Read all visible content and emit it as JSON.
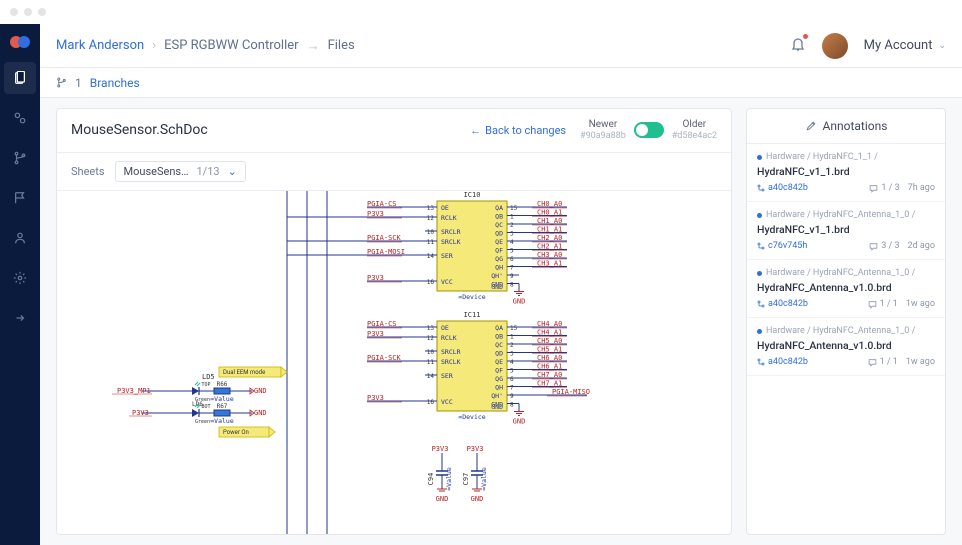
{
  "breadcrumb": {
    "user": "Mark Anderson",
    "project": "ESP RGBWW Controller",
    "page": "Files"
  },
  "account": {
    "label": "My Account"
  },
  "subbar": {
    "branch_count": "1",
    "branches_label": "Branches"
  },
  "doc": {
    "title": "MouseSensor.SchDoc"
  },
  "compare": {
    "back": "Back to changes",
    "newer": "Newer",
    "newer_hash": "#90a9a88b",
    "older": "Older",
    "older_hash": "#d58e4ac2"
  },
  "sheets": {
    "label": "Sheets",
    "name": "MouseSens…",
    "index": "1/13"
  },
  "annotations_title": "Annotations",
  "annotations": [
    {
      "path": "Hardware / HydraNFC_1_1 /",
      "file": "HydraNFC_v1_1.brd",
      "hash": "a40c842b",
      "count": "1 / 3",
      "time": "7h ago"
    },
    {
      "path": "Hardware / HydraNFC_Antenna_1_0 /",
      "file": "HydraNFC_v1_1.brd",
      "hash": "c76v745h",
      "count": "3 / 3",
      "time": "2d ago"
    },
    {
      "path": "Hardware / HydraNFC_Antenna_1_0 /",
      "file": "HydraNFC_Antenna_v1.0.brd",
      "hash": "a40c842b",
      "count": "1 / 1",
      "time": "1w ago"
    },
    {
      "path": "Hardware / HydraNFC_Antenna_1_0 /",
      "file": "HydraNFC_Antenna_v1.0.brd",
      "hash": "a40c842b",
      "count": "1 / 1",
      "time": "1w ago"
    }
  ],
  "schematic": {
    "ics": [
      "IC10",
      "IC11"
    ],
    "ic_pins_left": [
      {
        "n": "13",
        "lbl": "OE"
      },
      {
        "n": "12",
        "lbl": "RCLK"
      },
      {
        "n": "10",
        "lbl": "SRCLR"
      },
      {
        "n": "11",
        "lbl": "SRCLK"
      },
      {
        "n": "14",
        "lbl": "SER"
      },
      {
        "n": "16",
        "lbl": "VCC"
      }
    ],
    "ic_pins_right": [
      {
        "n": "15",
        "lbl": "QA"
      },
      {
        "n": "1",
        "lbl": "QB"
      },
      {
        "n": "2",
        "lbl": "QC"
      },
      {
        "n": "3",
        "lbl": "QD"
      },
      {
        "n": "4",
        "lbl": "QE"
      },
      {
        "n": "5",
        "lbl": "QF"
      },
      {
        "n": "6",
        "lbl": "QG"
      },
      {
        "n": "7",
        "lbl": "QH"
      },
      {
        "n": "9",
        "lbl": "QH'"
      },
      {
        "n": "8",
        "lbl": "GND"
      }
    ],
    "device_lbl": "=Device",
    "nets_left_ic10": [
      "PGIA-CS",
      "P3V3",
      "",
      "PGIA-SCK",
      "PGIA-MOSI",
      "P3V3"
    ],
    "nets_left_ic11": [
      "PGIA-CS",
      "P3V3",
      "",
      "PGIA-SCK",
      "",
      "P3V3"
    ],
    "nets_right_ic10": [
      "CH0_A0",
      "CH0_A1",
      "CH1_A0",
      "CH1_A1",
      "CH2_A0",
      "CH2_A1",
      "CH3_A0",
      "CH3_A1"
    ],
    "nets_right_ic11": [
      "CH4_A0",
      "CH4_A1",
      "CH5_A0",
      "CH5_A1",
      "CH6_A0",
      "CH6_A1",
      "CH7_A0",
      "CH7_A1",
      "PGIA-MISO"
    ],
    "gnd": "GND",
    "caps": [
      "C94",
      "C97"
    ],
    "cap_net": "P3V3",
    "cap_val": "=Value",
    "leds": {
      "ref1": "LD5",
      "ref2": "LD6",
      "r1": "R66",
      "r2": "R67",
      "top": "TOP",
      "bot": "BOT",
      "green": "Green",
      "val": "=Value"
    },
    "pwr_nets": [
      "P3V3_MP1",
      "P3V3"
    ],
    "notes": [
      "Dual EEM mode",
      "Power On"
    ]
  }
}
